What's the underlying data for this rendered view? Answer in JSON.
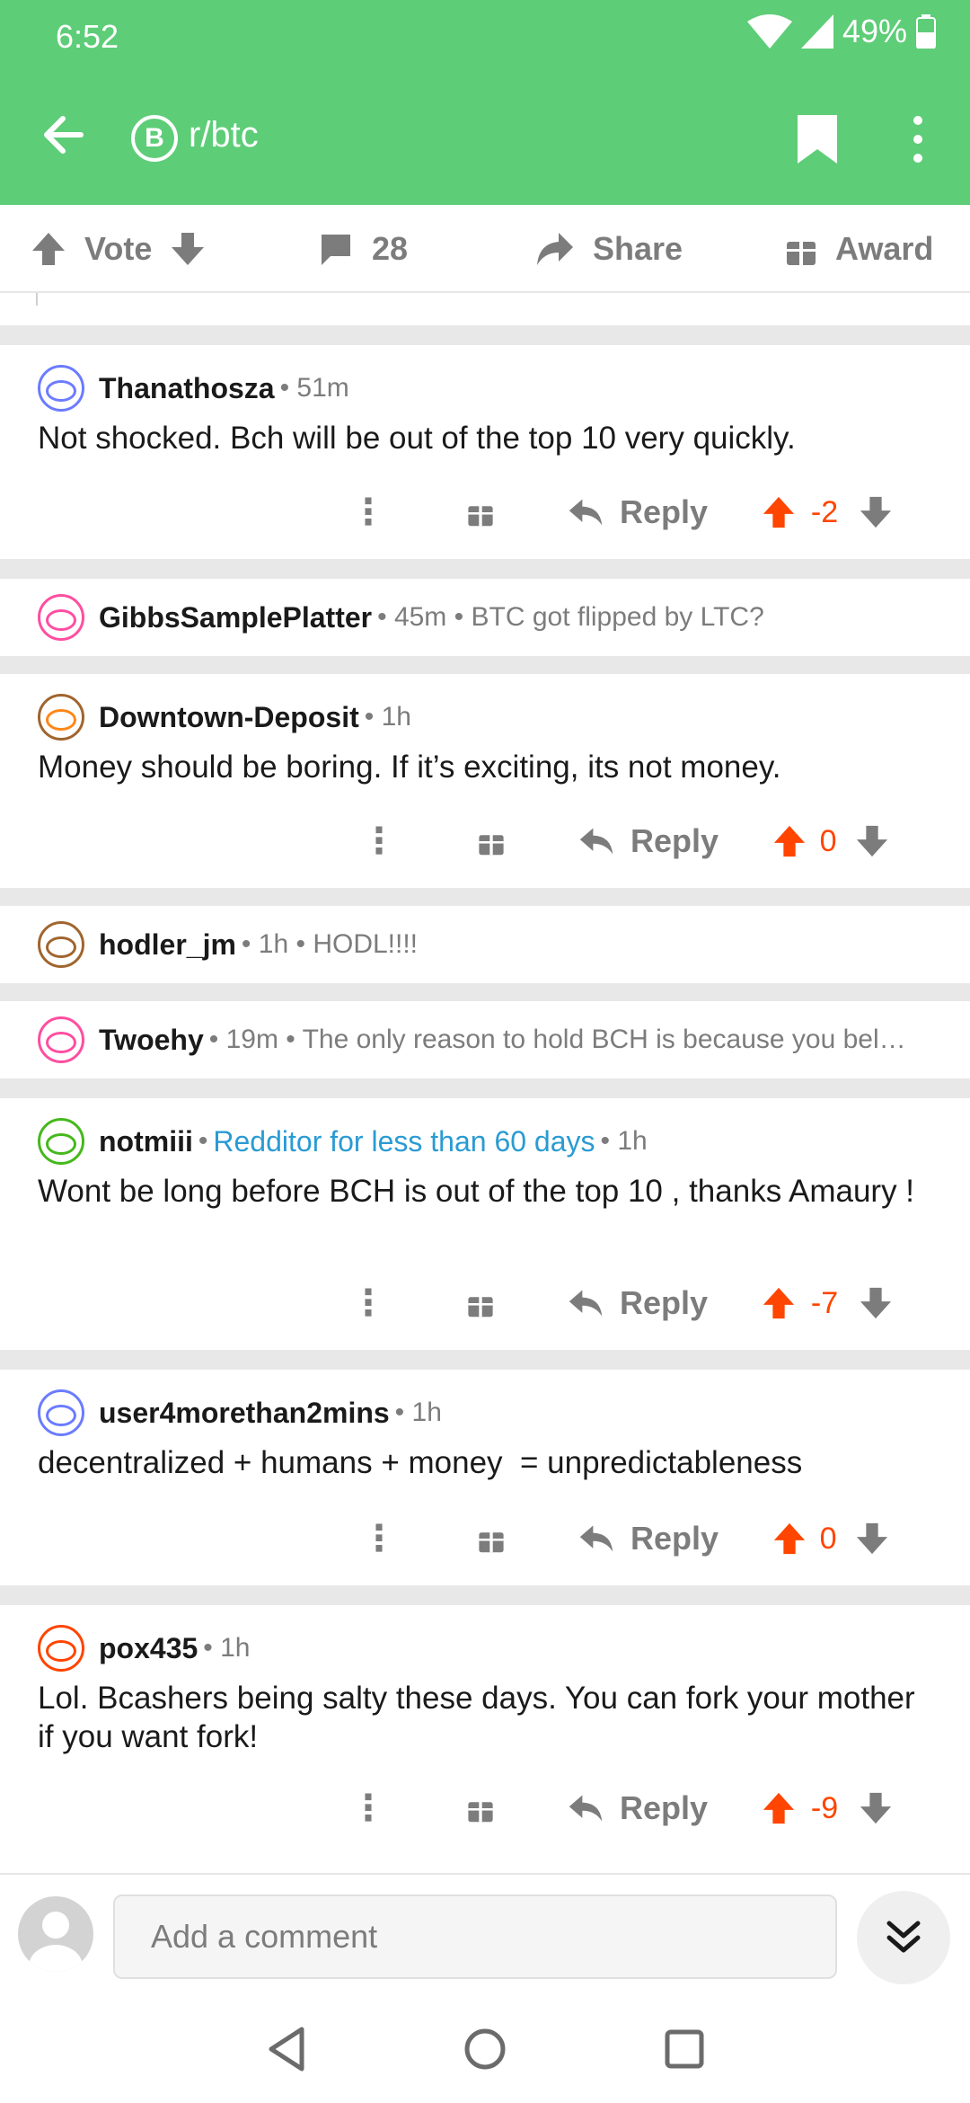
{
  "status_bar": {
    "time": "6:52",
    "battery": "49%"
  },
  "toolbar": {
    "subreddit": "r/btc",
    "sub_icon_glyph": "B"
  },
  "action_bar": {
    "vote": "Vote",
    "comments": "28",
    "share": "Share",
    "award": "Award"
  },
  "colors": {
    "brand_green": "#5ecd78",
    "upvote_orange": "#ff4500",
    "flair_blue": "#2a9bd3",
    "gray": "#7c7c7c"
  },
  "comments": [
    {
      "author": "Thanathosza",
      "time": "51m",
      "body": "Not shocked. Bch will be out of the top 10 very quickly.",
      "reply": "Reply",
      "score": "-2",
      "avatar_color": "#6b7cff"
    },
    {
      "author": "GibbsSamplePlatter",
      "time": "45m",
      "preview": "BTC got flipped by LTC?",
      "collapsed": true,
      "avatar_color": "#ff4ea0"
    },
    {
      "author": "Downtown-Deposit",
      "time": "1h",
      "body": "Money should be boring. If it’s exciting, its not money.",
      "reply": "Reply",
      "score": "0",
      "avatar_color": "#a0652e"
    },
    {
      "author": "hodler_jm",
      "time": "1h",
      "preview": "HODL!!!!",
      "collapsed": true,
      "avatar_color": "#a0652e"
    },
    {
      "author": "Twoehy",
      "time": "19m",
      "preview": "The only reason to hold BCH is because you bel…",
      "collapsed": true,
      "avatar_color": "#ff4ea0"
    },
    {
      "author": "notmiii",
      "flair": "Redditor for less than 60 days",
      "time": "1h",
      "body": "Wont be long before BCH is out of the top 10 , thanks Amaury !",
      "reply": "Reply",
      "score": "-7",
      "avatar_color": "#46b81c"
    },
    {
      "author": "user4morethan2mins",
      "time": "1h",
      "body": "decentralized + humans + money  = unpredictableness",
      "reply": "Reply",
      "score": "0",
      "avatar_color": "#6b7cff"
    },
    {
      "author": "pox435",
      "time": "1h",
      "body": "Lol. Bcashers being salty these days. You can fork your mother if you want fork!",
      "reply": "Reply",
      "score": "-9",
      "avatar_color": "#ff4500"
    }
  ],
  "comment_bar": {
    "placeholder": "Add a comment"
  }
}
